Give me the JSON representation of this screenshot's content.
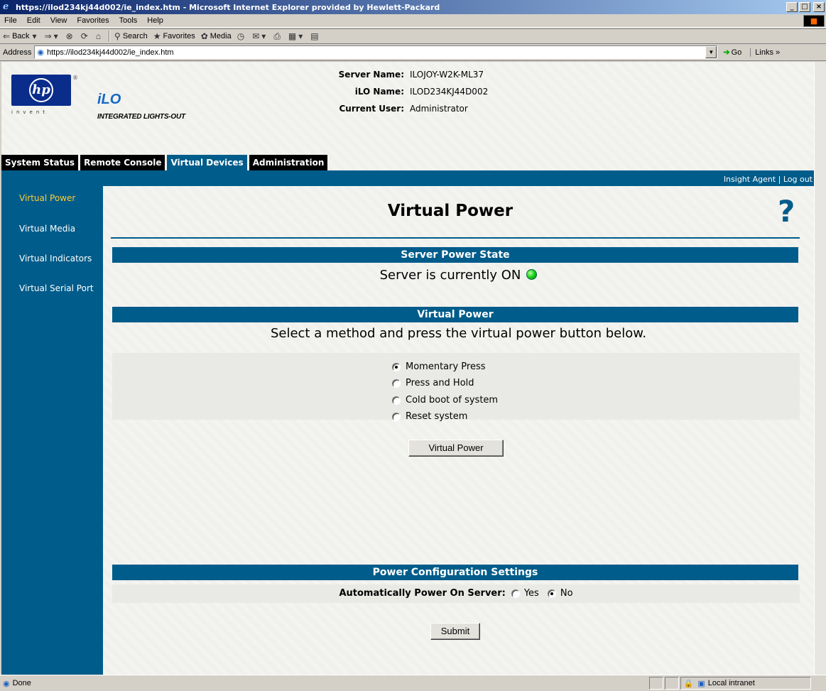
{
  "window": {
    "title": "https://ilod234kj44d002/ie_index.htm - Microsoft Internet Explorer provided by Hewlett-Packard",
    "min": "_",
    "max": "□",
    "close": "×"
  },
  "menubar": [
    "File",
    "Edit",
    "View",
    "Favorites",
    "Tools",
    "Help"
  ],
  "toolbar": {
    "back": "Back",
    "search": "Search",
    "favorites": "Favorites",
    "media": "Media"
  },
  "address": {
    "label": "Address",
    "url": "https://ilod234kj44d002/ie_index.htm",
    "go": "Go",
    "links": "Links"
  },
  "header": {
    "logo_tagline": "invent",
    "brand": "iLO",
    "brand_sub": "INTEGRATED LIGHTS-OUT",
    "server_name_label": "Server Name:",
    "server_name": "ILOJOY-W2K-ML37",
    "ilo_name_label": "iLO Name:",
    "ilo_name": "ILOD234KJ44D002",
    "user_label": "Current User:",
    "user": "Administrator"
  },
  "tabs": [
    {
      "label": "System Status",
      "active": false
    },
    {
      "label": "Remote Console",
      "active": false
    },
    {
      "label": "Virtual Devices",
      "active": true
    },
    {
      "label": "Administration",
      "active": false
    }
  ],
  "toplinks": "Insight Agent | Log out",
  "sidenav": [
    {
      "label": "Virtual Power",
      "active": true
    },
    {
      "label": "Virtual Media",
      "active": false
    },
    {
      "label": "Virtual Indicators",
      "active": false
    },
    {
      "label": "Virtual Serial Port",
      "active": false
    }
  ],
  "main": {
    "title": "Virtual Power",
    "help": "?",
    "power_state_header": "Server Power State",
    "power_state_text": "Server is currently ON",
    "power_state_color": "#18d018",
    "virtual_power_header": "Virtual Power",
    "instruction": "Select a method and press the virtual power button below.",
    "methods": [
      {
        "label": "Momentary Press",
        "checked": true
      },
      {
        "label": "Press and Hold",
        "checked": false
      },
      {
        "label": "Cold boot of system",
        "checked": false
      },
      {
        "label": "Reset system",
        "checked": false
      }
    ],
    "power_button": "Virtual Power",
    "config_header": "Power Configuration Settings",
    "auto_power_label": "Automatically Power On Server:",
    "auto_power_options": [
      {
        "label": "Yes",
        "checked": false
      },
      {
        "label": "No",
        "checked": true
      }
    ],
    "submit": "Submit"
  },
  "status": {
    "text": "Done",
    "zone": "Local intranet"
  },
  "colors": {
    "accent": "#005c8a",
    "active_nav": "#ffcc33"
  }
}
